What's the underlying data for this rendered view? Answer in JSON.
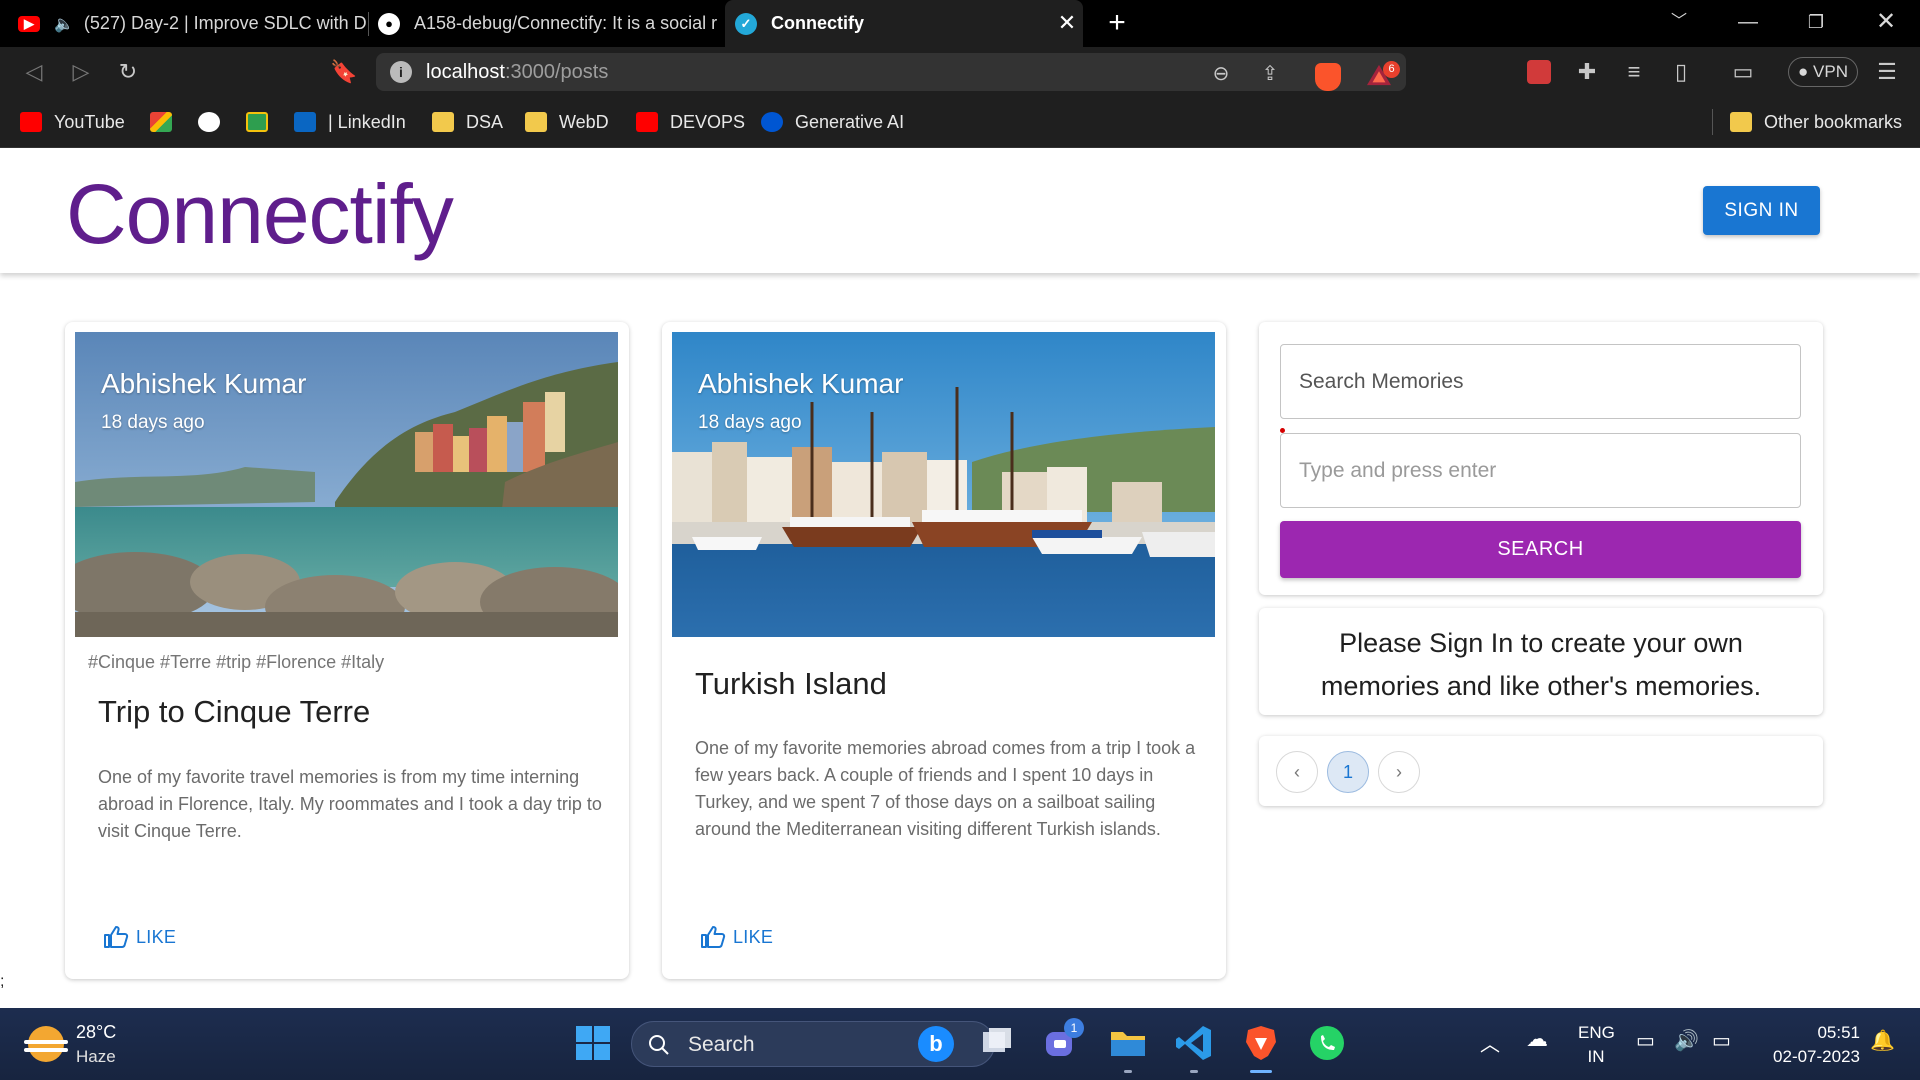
{
  "browser": {
    "tabs": [
      {
        "title": "(527) Day-2 | Improve SDLC with D"
      },
      {
        "title": "A158-debug/Connectify: It is a social r"
      },
      {
        "title": "Connectify"
      }
    ],
    "url_host": "localhost",
    "url_path": ":3000/posts",
    "vpn_label": "VPN",
    "rewards_badge": "6",
    "bookmarks": [
      {
        "label": "YouTube",
        "icon": "youtube-icon"
      },
      {
        "label": "",
        "icon": "gmail-icon"
      },
      {
        "label": "",
        "icon": "github-icon"
      },
      {
        "label": "",
        "icon": "classroom-icon"
      },
      {
        "label": "| LinkedIn",
        "icon": "linkedin-icon"
      },
      {
        "label": "DSA",
        "icon": "folder-icon"
      },
      {
        "label": "WebD",
        "icon": "folder-icon"
      },
      {
        "label": "DEVOPS",
        "icon": "youtube-icon"
      },
      {
        "label": "Generative AI",
        "icon": "coursera-icon"
      }
    ],
    "other_bookmarks": "Other bookmarks"
  },
  "app": {
    "brand": "Connectify",
    "signin_label": "SIGN IN",
    "brand_color": "#5f1e8c",
    "primary_color": "#1976d2",
    "secondary_color": "#9c27b0"
  },
  "posts": [
    {
      "author": "Abhishek Kumar",
      "time": "18 days ago",
      "tags": "#Cinque #Terre #trip #Florence #Italy",
      "title": "Trip to Cinque Terre",
      "message": "One of my favorite travel memories is from my time interning abroad in Florence, Italy. My roommates and I took a day trip to visit Cinque Terre.",
      "like_label": "LIKE"
    },
    {
      "author": "Abhishek Kumar",
      "time": "18 days ago",
      "tags": "",
      "title": "Turkish Island",
      "message": "One of my favorite memories abroad comes from a trip I took a few years back. A couple of friends and I spent 10 days in Turkey, and we spent 7 of those days on a sailboat sailing around the Mediterranean visiting different Turkish islands.",
      "like_label": "LIKE"
    }
  ],
  "search": {
    "memories_placeholder": "Search Memories",
    "tags_placeholder": "Type and press enter",
    "button_label": "SEARCH"
  },
  "signin_message": "Please Sign In to create your own memories and like other's memories.",
  "pagination": {
    "current_page": "1",
    "prev": "‹",
    "next": "›"
  },
  "stray_text": ";",
  "taskbar": {
    "temperature": "28°C",
    "condition": "Haze",
    "search_label": "Search",
    "teams_badge": "1",
    "language": "ENG",
    "region": "IN",
    "time": "05:51",
    "date": "02-07-2023"
  }
}
